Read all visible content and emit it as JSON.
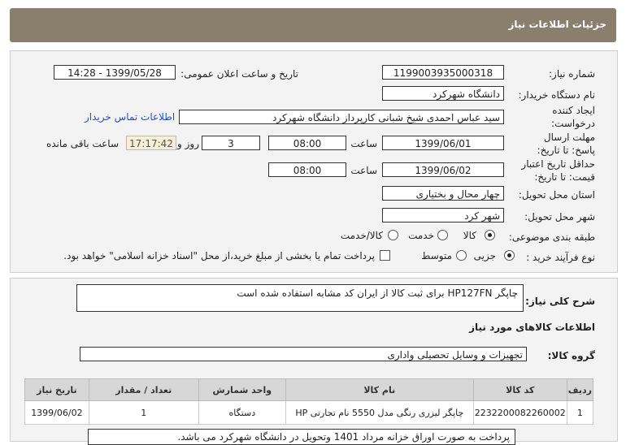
{
  "header": {
    "title": "جزئیات اطلاعات نیاز"
  },
  "form": {
    "need_number_label": "شماره نیاز:",
    "need_number": "1199003935000318",
    "announce_label": "تاریخ و ساعت اعلان عمومی:",
    "announce_value": "1399/05/28 - 14:28",
    "buyer_label": "نام دستگاه خریدار:",
    "buyer_value": "دانشگاه شهرکرد",
    "creator_label": "ایجاد کننده درخواست:",
    "creator_value": "سید عباس احمدی شیخ شبانی کارپرداز دانشگاه شهرکرد",
    "contact_link": "اطلاعات تماس خریدار",
    "deadline_label": "مهلت ارسال پاسخ: تا تاریخ:",
    "deadline_date": "1399/06/01",
    "time_label": "ساعت",
    "deadline_time": "08:00",
    "days_value": "3",
    "days_label": "روز و",
    "timer_value": "17:17:42",
    "remaining_label": "ساعت باقی مانده",
    "validity_label": "حداقل تاریخ اعتبار قیمت: تا تاریخ:",
    "validity_date": "1399/06/02",
    "validity_time": "08:00",
    "province_label": "استان محل تحویل:",
    "province_value": "چهار محال و بختیاری",
    "city_label": "شهر محل تحویل:",
    "city_value": "شهر کرد",
    "category_label": "طبقه بندی موضوعی:",
    "category_options": [
      "کالا",
      "خدمت",
      "کالا/خدمت"
    ],
    "category_selected": "کالا",
    "process_label": "نوع فرآیند خرید :",
    "process_options": [
      "جزیی",
      "متوسط"
    ],
    "process_selected": "جزیی",
    "payment_note": "پرداخت تمام یا بخشی از مبلغ خرید،از محل \"اسناد خزانه اسلامی\" خواهد بود."
  },
  "details": {
    "summary_label": "شرح کلی نیاز:",
    "summary_value": "چاپگر HP127FN برای ثبت کالا از ایران کد مشابه استفاده شده است",
    "goods_info_title": "اطلاعات کالاهای مورد نیاز",
    "group_label": "گروه کالا:",
    "group_value": "تجهیزات و وسایل تحصیلی واداری",
    "table": {
      "headers": [
        "ردیف",
        "کد کالا",
        "نام کالا",
        "واحد شمارش",
        "تعداد / مقدار",
        "تاریخ نیاز"
      ],
      "rows": [
        [
          "1",
          "2232200082260002",
          "چاپگر لیزری رنگی مدل 5550 نام تجارتی HP",
          "دستگاه",
          "1",
          "1399/06/02"
        ]
      ]
    },
    "note_value": "پرداخت به صورت اوراق  خزانه مرداد 1401 وتحویل در دانشگاه شهرکرد می باشد."
  },
  "colors": {
    "header_bg": "#8a7e6d",
    "panel_bg": "#f3f3f3",
    "timer_bg": "#f6f1d6",
    "link": "#1a4fd0"
  }
}
